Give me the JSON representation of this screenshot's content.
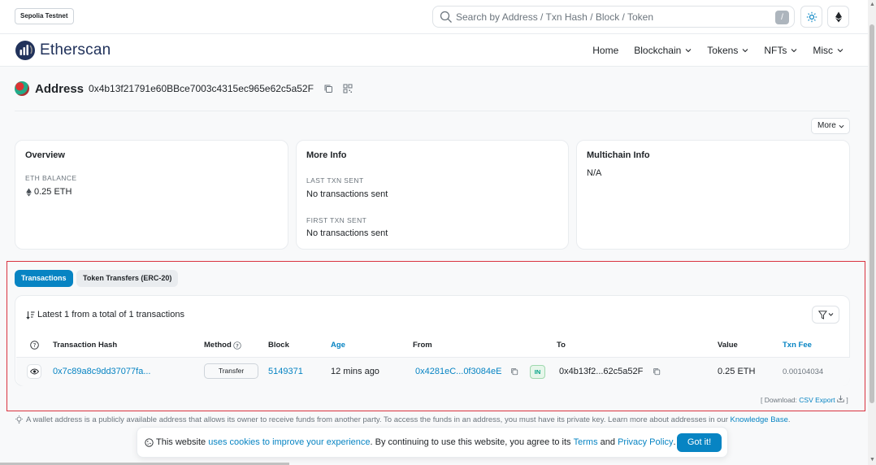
{
  "topbar": {
    "network": "Sepolia Testnet",
    "search_placeholder": "Search by Address / Txn Hash / Block / Token",
    "slash_key": "/",
    "icons": [
      "sun-icon",
      "ethereum-icon"
    ]
  },
  "nav": {
    "logo_text": "Etherscan",
    "items": [
      {
        "label": "Home",
        "dropdown": false
      },
      {
        "label": "Blockchain",
        "dropdown": true
      },
      {
        "label": "Tokens",
        "dropdown": true
      },
      {
        "label": "NFTs",
        "dropdown": true
      },
      {
        "label": "Misc",
        "dropdown": true
      }
    ]
  },
  "address": {
    "label": "Address",
    "hash": "0x4b13f21791e60BBce7003c4315ec965e62c5a52F",
    "more_label": "More"
  },
  "overview": {
    "title": "Overview",
    "balance_label": "ETH BALANCE",
    "balance_value": "0.25 ETH"
  },
  "more_info": {
    "title": "More Info",
    "last_label": "LAST TXN SENT",
    "last_value": "No transactions sent",
    "first_label": "FIRST TXN SENT",
    "first_value": "No transactions sent"
  },
  "multichain": {
    "title": "Multichain Info",
    "value": "N/A"
  },
  "tabs": {
    "transactions": "Transactions",
    "token_transfers": "Token Transfers (ERC-20)"
  },
  "transactions": {
    "summary": "Latest 1 from a total of 1 transactions",
    "columns": {
      "hash": "Transaction Hash",
      "method": "Method",
      "block": "Block",
      "age": "Age",
      "from": "From",
      "to": "To",
      "value": "Value",
      "fee": "Txn Fee"
    },
    "rows": [
      {
        "hash": "0x7c89a8c9dd37077fa...",
        "method": "Transfer",
        "block": "5149371",
        "age": "12 mins ago",
        "from": "0x4281eC...0f3084eE",
        "direction": "IN",
        "to": "0x4b13f2...62c5a52F",
        "value": "0.25 ETH",
        "fee": "0.00104034"
      }
    ],
    "download_prefix": "[ Download:",
    "download_link": "CSV Export",
    "download_suffix": "]"
  },
  "footer": {
    "note": "A wallet address is a publicly available address that allows its owner to receive funds from another party. To access the funds in an address, you must have its private key. Learn more about addresses in our",
    "note_link": "Knowledge Base",
    "note_end": "."
  },
  "cookie": {
    "text1": "This website",
    "link1": "uses cookies to improve your experience",
    "text2": ". By continuing to use this website, you agree to its",
    "link2": "Terms",
    "text3": "and",
    "link3": "Privacy Policy",
    "text4": ".",
    "button": "Got it!"
  },
  "colors": {
    "accent": "#0784c3",
    "highlight": "#d9323f",
    "in_badge": "#00a186"
  }
}
